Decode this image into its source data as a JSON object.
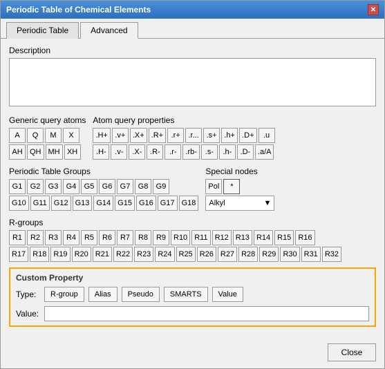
{
  "window": {
    "title": "Periodic Table of Chemical Elements",
    "close_label": "✕"
  },
  "tabs": [
    {
      "label": "Periodic Table",
      "active": false
    },
    {
      "label": "Advanced",
      "active": true
    }
  ],
  "advanced": {
    "description_label": "Description",
    "description_placeholder": "",
    "generic_query_label": "Generic query atoms",
    "generic_row1": [
      "A",
      "Q",
      "M",
      "X"
    ],
    "generic_row2": [
      "AH",
      "QH",
      "MH",
      "XH"
    ],
    "atom_query_label": "Atom query properties",
    "atom_row1": [
      ".H+",
      ".v+",
      ".X+",
      ".R+",
      ".r+",
      ".r...",
      ".s+",
      ".h+",
      ".D+",
      ".u"
    ],
    "atom_row2": [
      ".H-",
      ".v-",
      ".X-",
      ".R-",
      ".r-",
      ".rb-",
      ".s-",
      ".h-",
      ".D-",
      ".a/A"
    ],
    "periodic_groups_label": "Periodic Table Groups",
    "groups_row1": [
      "G1",
      "G2",
      "G3",
      "G4",
      "G5",
      "G6",
      "G7",
      "G8",
      "G9"
    ],
    "groups_row2": [
      "G10",
      "G11",
      "G12",
      "G13",
      "G14",
      "G15",
      "G16",
      "G17",
      "G18"
    ],
    "special_nodes_label": "Special nodes",
    "special_row1": [
      "Pol",
      "*"
    ],
    "alkyl_value": "Alkyl",
    "rgroups_label": "R-groups",
    "rgroups_row1": [
      "R1",
      "R2",
      "R3",
      "R4",
      "R5",
      "R6",
      "R7",
      "R8",
      "R9",
      "R10",
      "R11",
      "R12",
      "R13",
      "R14",
      "R15",
      "R16"
    ],
    "rgroups_row2": [
      "R17",
      "R18",
      "R19",
      "R20",
      "R21",
      "R22",
      "R23",
      "R24",
      "R25",
      "R26",
      "R27",
      "R28",
      "R29",
      "R30",
      "R31",
      "R32"
    ],
    "custom_property_label": "Custom Property",
    "type_label": "Type:",
    "type_buttons": [
      "R-group",
      "Alias",
      "Pseudo",
      "SMARTS",
      "Value"
    ],
    "value_label": "Value:",
    "value_placeholder": ""
  },
  "footer": {
    "close_label": "Close"
  }
}
